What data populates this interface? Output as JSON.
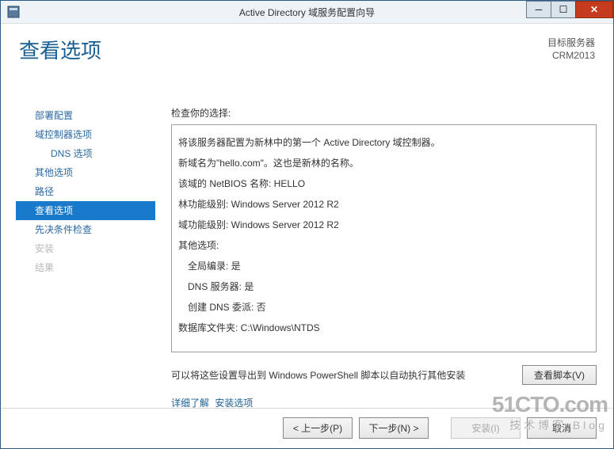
{
  "window": {
    "title": "Active Directory 域服务配置向导"
  },
  "header": {
    "pageTitle": "查看选项",
    "targetLabel": "目标服务器",
    "targetName": "CRM2013"
  },
  "nav": {
    "items": [
      {
        "label": "部署配置",
        "cls": "link"
      },
      {
        "label": "域控制器选项",
        "cls": "link"
      },
      {
        "label": "DNS 选项",
        "cls": "link sub"
      },
      {
        "label": "其他选项",
        "cls": "link"
      },
      {
        "label": "路径",
        "cls": "link"
      },
      {
        "label": "查看选项",
        "cls": "active"
      },
      {
        "label": "先决条件检查",
        "cls": "link"
      },
      {
        "label": "安装",
        "cls": "disabled"
      },
      {
        "label": "结果",
        "cls": "disabled"
      }
    ]
  },
  "main": {
    "prompt": "检查你的选择:",
    "summaryLines": [
      {
        "text": "将该服务器配置为新林中的第一个 Active Directory 域控制器。"
      },
      {
        "text": "新域名为\"hello.com\"。这也是新林的名称。"
      },
      {
        "text": "该域的 NetBIOS 名称: HELLO"
      },
      {
        "text": "林功能级别: Windows Server 2012 R2"
      },
      {
        "text": "域功能级别: Windows Server 2012 R2"
      },
      {
        "text": "其他选项:"
      },
      {
        "text": "全局编录: 是",
        "cls": "indent"
      },
      {
        "text": "DNS 服务器: 是",
        "cls": "indent"
      },
      {
        "text": "创建 DNS 委派: 否",
        "cls": "indent"
      },
      {
        "text": "数据库文件夹: C:\\Windows\\NTDS"
      }
    ],
    "exportText": "可以将这些设置导出到 Windows PowerShell 脚本以自动执行其他安装",
    "viewScriptBtn": "查看脚本(V)",
    "moreLink1": "详细了解",
    "moreLink2": "安装选项"
  },
  "footer": {
    "prev": "< 上一步(P)",
    "next": "下一步(N) >",
    "install": "安装(I)",
    "cancel": "取消"
  },
  "watermark": {
    "main": "51CTO.com",
    "sub": "技术博客 Blog"
  }
}
